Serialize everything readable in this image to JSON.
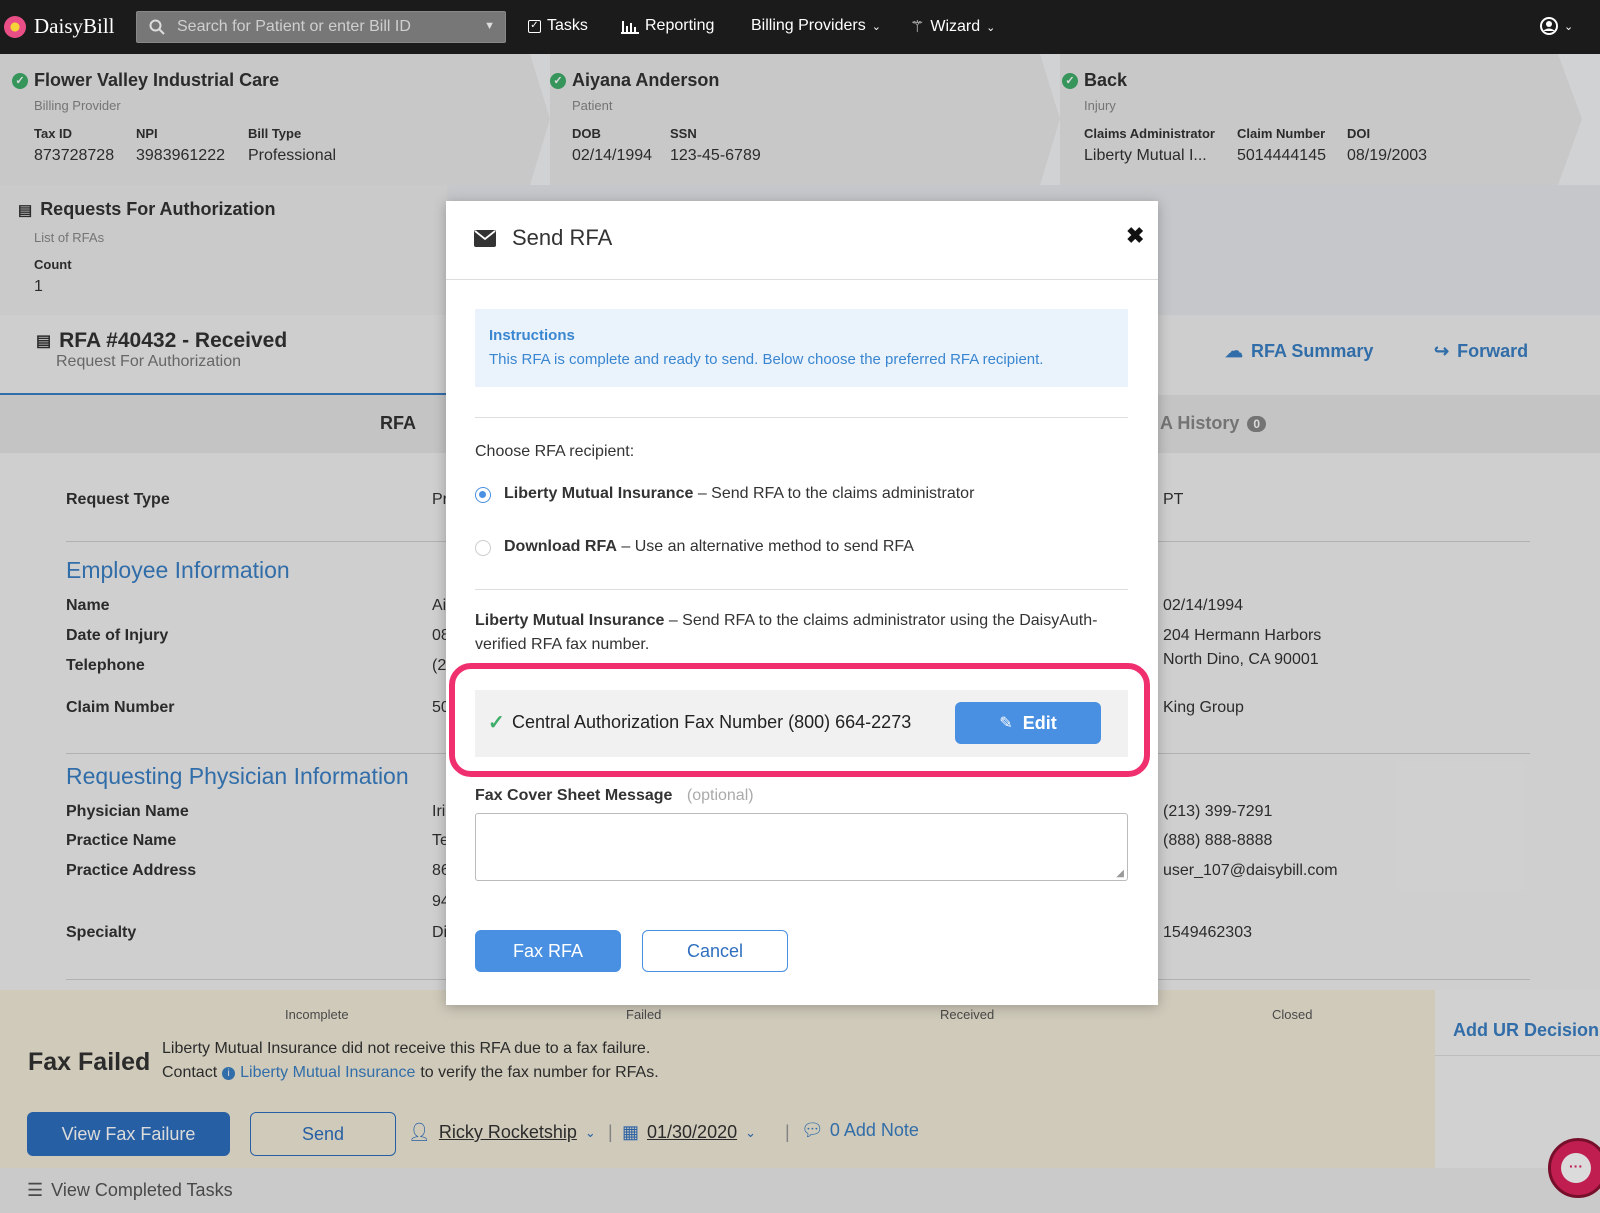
{
  "nav": {
    "logo": "DaisyBill",
    "search_placeholder": "Search for Patient or enter Bill ID",
    "tasks": "Tasks",
    "reporting": "Reporting",
    "billing_providers": "Billing Providers",
    "wizard": "Wizard"
  },
  "provider": {
    "name": "Flower Valley Industrial Care",
    "role": "Billing Provider",
    "tax_id_label": "Tax ID",
    "tax_id": "873728728",
    "npi_label": "NPI",
    "npi": "3983961222",
    "bill_type_label": "Bill Type",
    "bill_type": "Professional"
  },
  "patient": {
    "name": "Aiyana Anderson",
    "role": "Patient",
    "dob_label": "DOB",
    "dob": "02/14/1994",
    "ssn_label": "SSN",
    "ssn": "123-45-6789"
  },
  "injury": {
    "name": "Back",
    "role": "Injury",
    "ca_label": "Claims Administrator",
    "ca": "Liberty Mutual I...",
    "claim_label": "Claim Number",
    "claim": "5014444145",
    "doi_label": "DOI",
    "doi": "08/19/2003"
  },
  "rfa_list": {
    "title": "Requests For Authorization",
    "sub": "List of RFAs",
    "count_label": "Count",
    "count": "1"
  },
  "rfa": {
    "title": "RFA #40432 - Received",
    "sub": "Request For Authorization",
    "summary": "RFA Summary",
    "forward": "Forward",
    "tab_rfa": "RFA",
    "tab_history": "A History",
    "history_count": "0"
  },
  "details": {
    "request_type_label": "Request Type",
    "request_type_frag": "Pr",
    "request_type_right": "PT",
    "employee_section": "Employee Information",
    "name_label": "Name",
    "name_frag": "Ai",
    "doi_label": "Date of Injury",
    "doi_frag": "08",
    "tel_label": "Telephone",
    "tel_frag": "(2",
    "claim_label": "Claim Number",
    "claim_frag": "50",
    "dob_right": "02/14/1994",
    "addr1_right": "204 Hermann Harbors",
    "addr2_right": "North Dino, CA 90001",
    "employer_right": "King Group",
    "physician_section": "Requesting Physician Information",
    "phys_label": "Physician Name",
    "phys_frag": "Iri",
    "practice_label": "Practice Name",
    "practice_frag": "Te",
    "paddr_label": "Practice Address",
    "paddr_frag1": "86",
    "paddr_frag2": "94",
    "spec_label": "Specialty",
    "spec_frag": "Di",
    "phone_right": "(213) 399-7291",
    "fax_right": "(888) 888-8888",
    "email_right": "user_107@daisybill.com",
    "npi_right": "1549462303"
  },
  "status": {
    "steps": [
      "Incomplete",
      "Failed",
      "Received",
      "Closed"
    ],
    "title": "Fax Failed",
    "msg1": "Liberty Mutual Insurance did not receive this RFA due to a fax failure.",
    "msg2_pre": "Contact",
    "msg2_link": "Liberty Mutual Insurance",
    "msg2_post": "to verify the fax number for RFAs.",
    "view_fail": "View Fax Failure",
    "send": "Send",
    "assignee": "Ricky Rocketship",
    "date": "01/30/2020",
    "add_note": "0 Add Note",
    "add_ur": "Add UR Decision",
    "view_completed": "View Completed Tasks"
  },
  "modal": {
    "title": "Send RFA",
    "instructions_title": "Instructions",
    "instructions_text": "This RFA is complete and ready to send. Below choose the preferred RFA recipient.",
    "choose_label": "Choose RFA recipient:",
    "opt1_bold": "Liberty Mutual Insurance",
    "opt1_rest": "– Send RFA to the claims administrator",
    "opt2_bold": "Download RFA",
    "opt2_rest": "– Use an alternative method to send RFA",
    "desc_bold": "Liberty Mutual Insurance",
    "desc_rest": "– Send RFA to the claims administrator using the DaisyAuth-verified RFA fax number.",
    "fax_text": "Central Authorization Fax Number (800) 664-2273",
    "edit": "Edit",
    "cover_label": "Fax Cover Sheet Message",
    "cover_optional": "(optional)",
    "fax_btn": "Fax RFA",
    "cancel_btn": "Cancel"
  },
  "colors": {
    "accent": "#4a90e2",
    "highlight": "#f0306e",
    "success": "#3fae6a"
  }
}
